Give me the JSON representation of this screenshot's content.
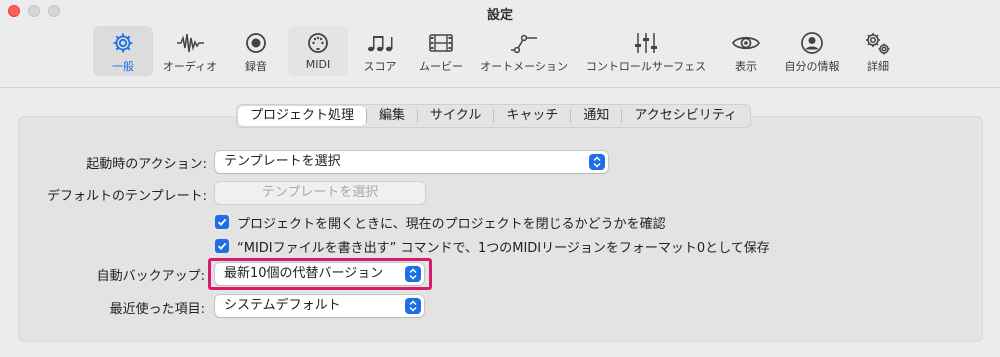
{
  "window": {
    "title": "設定"
  },
  "toolbar": {
    "items": [
      {
        "label": "一般",
        "icon": "gear-icon"
      },
      {
        "label": "オーディオ",
        "icon": "waveform-icon"
      },
      {
        "label": "録音",
        "icon": "record-icon"
      },
      {
        "label": "MIDI",
        "icon": "midi-connector-icon"
      },
      {
        "label": "スコア",
        "icon": "music-notes-icon"
      },
      {
        "label": "ムービー",
        "icon": "film-icon"
      },
      {
        "label": "オートメーション",
        "icon": "automation-curve-icon"
      },
      {
        "label": "コントロールサーフェス",
        "icon": "sliders-icon"
      },
      {
        "label": "表示",
        "icon": "eye-icon"
      },
      {
        "label": "自分の情報",
        "icon": "person-icon"
      },
      {
        "label": "詳細",
        "icon": "gears-icon"
      }
    ],
    "selected_index": 0
  },
  "tabs": {
    "items": [
      "プロジェクト処理",
      "編集",
      "サイクル",
      "キャッチ",
      "通知",
      "アクセシビリティ"
    ],
    "selected_index": 0
  },
  "form": {
    "startup_action": {
      "label": "起動時のアクション:",
      "value": "テンプレートを選択"
    },
    "default_template": {
      "label": "デフォルトのテンプレート:",
      "button": "テンプレートを選択"
    },
    "check_close_project": {
      "label": "プロジェクトを開くときに、現在のプロジェクトを閉じるかどうかを確認",
      "checked": true
    },
    "check_midi_save": {
      "label": "“MIDIファイルを書き出す” コマンドで、1つのMIDIリージョンをフォーマット0として保存",
      "checked": true
    },
    "auto_backup": {
      "label": "自動バックアップ:",
      "value": "最新10個の代替バージョン"
    },
    "recent_items": {
      "label": "最近使った項目:",
      "value": "システムデフォルト"
    }
  },
  "colors": {
    "accent": "#1e6ee8",
    "highlight": "#d61a6c",
    "close": "#ff5f57"
  }
}
